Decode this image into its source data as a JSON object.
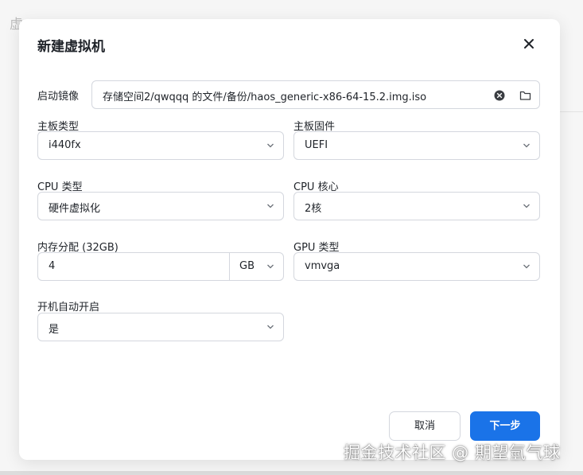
{
  "background": {
    "partial_char": "虚"
  },
  "dialog": {
    "title": "新建虚拟机",
    "boot_image": {
      "label": "启动镜像",
      "value": "存储空间2/qwqqq 的文件/备份/haos_generic-x86-64-15.2.img.iso"
    },
    "motherboard_type": {
      "label": "主板类型",
      "value": "i440fx"
    },
    "motherboard_firmware": {
      "label": "主板固件",
      "value": "UEFI"
    },
    "cpu_type": {
      "label": "CPU 类型",
      "value": "硬件虚拟化"
    },
    "cpu_cores": {
      "label": "CPU 核心",
      "value": "2核"
    },
    "memory": {
      "label": "内存分配 (32GB)",
      "value": "4",
      "unit": "GB"
    },
    "gpu_type": {
      "label": "GPU 类型",
      "value": "vmvga"
    },
    "autostart": {
      "label": "开机自动开启",
      "value": "是"
    },
    "buttons": {
      "cancel": "取消",
      "next": "下一步"
    }
  },
  "watermark": "掘金技术社区 @ 期望氫气球",
  "colors": {
    "primary": "#1a73e8",
    "border": "#d4d7de",
    "text": "#1f2329"
  },
  "icons": [
    "close-icon",
    "clear-icon",
    "folder-icon",
    "chevron-down-icon"
  ]
}
